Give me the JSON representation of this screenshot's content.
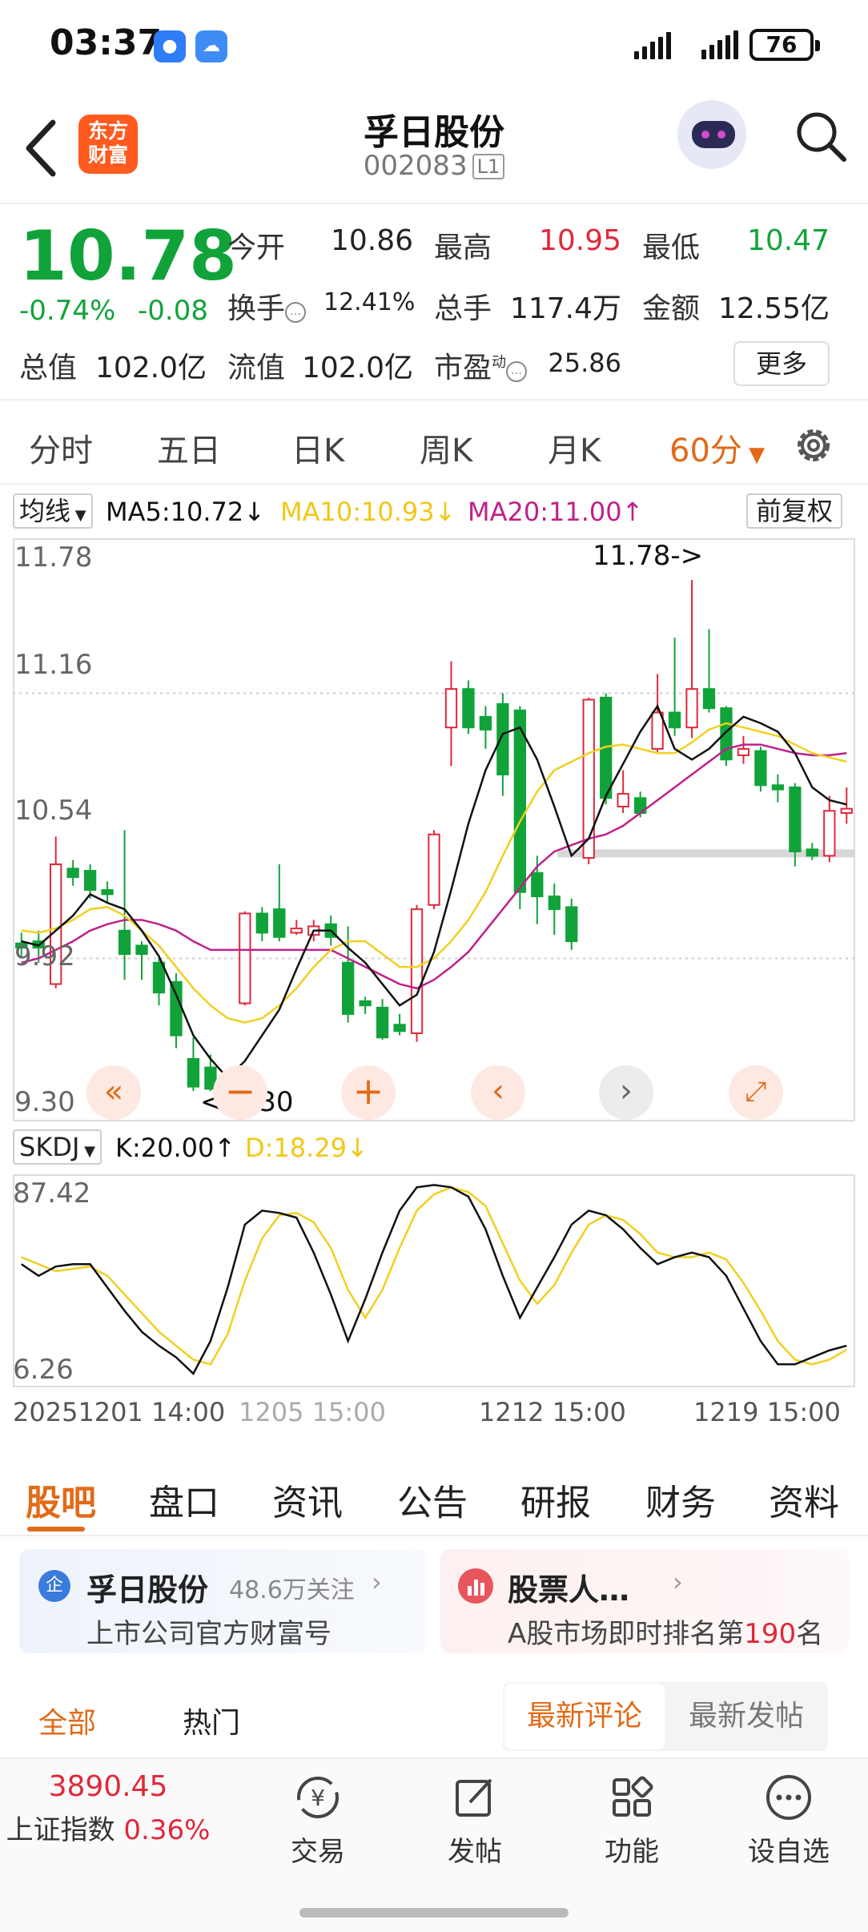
{
  "status_bar": {
    "time": "03:37",
    "battery": "76"
  },
  "header": {
    "logo_line1": "东方",
    "logo_line2": "财富",
    "stock_name": "孚日股份",
    "stock_code": "002083",
    "level_badge": "L1"
  },
  "quote": {
    "price": "10.78",
    "change_pct": "-0.74%",
    "change_amt": "-0.08",
    "open_label": "今开",
    "open": "10.86",
    "high_label": "最高",
    "high": "10.95",
    "low_label": "最低",
    "low": "10.47",
    "turnover_label": "换手",
    "turnover": "12.41%",
    "volume_label": "总手",
    "volume": "117.4万",
    "amount_label": "金额",
    "amount": "12.55亿",
    "mktcap_label": "总值",
    "mktcap": "102.0亿",
    "float_label": "流值",
    "float_cap": "102.0亿",
    "pe_label": "市盈",
    "pe_sup": "动",
    "pe": "25.86",
    "more": "更多"
  },
  "period_tabs": [
    "分时",
    "五日",
    "日K",
    "周K",
    "月K",
    "60分"
  ],
  "ma_legend": {
    "selector": "均线",
    "ma5": "MA5:10.72↓",
    "ma10": "MA10:10.93↓",
    "ma20": "MA20:11.00↑",
    "adjust": "前复权"
  },
  "price_axis": [
    "11.78",
    "11.16",
    "10.54",
    "9.92",
    "9.30"
  ],
  "annotations": {
    "high_marker": "11.78->",
    "low_marker": "<-9.30"
  },
  "indicator": {
    "selector": "SKDJ",
    "k": "K:20.00↑",
    "d": "D:18.29↓",
    "axis_top": "87.42",
    "axis_bottom": "6.26"
  },
  "time_axis": [
    "20251201 14:00",
    "1205 15:00",
    "1212 15:00",
    "1219 15:00"
  ],
  "main_tabs": [
    "股吧",
    "盘口",
    "资讯",
    "公告",
    "研报",
    "财务",
    "资料"
  ],
  "card_left": {
    "badge": "企",
    "title": "孚日股份",
    "followers": "48.6万关注",
    "subtitle": "上市公司官方财富号"
  },
  "card_right": {
    "title": "股票人…",
    "subtitle_prefix": "A股市场即时排名第",
    "rank": "190",
    "subtitle_suffix": "名"
  },
  "filter": {
    "all": "全部",
    "hot": "热门",
    "latest_comment": "最新评论",
    "latest_post": "最新发帖"
  },
  "bottom_bar": {
    "index_value": "3890.45",
    "index_name": "上证指数",
    "index_change": "0.36%",
    "trade": "交易",
    "post": "发帖",
    "functions": "功能",
    "watchlist": "设自选"
  },
  "colors": {
    "up": "#e0283a",
    "down": "#11a33a",
    "accent": "#e26a18",
    "ma5": "#111111",
    "ma10": "#f0d020",
    "ma20": "#c0208a"
  },
  "chart_data": {
    "type": "candlestick",
    "period": "60分",
    "ylim": [
      9.3,
      11.78
    ],
    "candles": [
      {
        "o": 9.99,
        "c": 9.97,
        "h": 10.04,
        "l": 9.93
      },
      {
        "o": 10.0,
        "c": 9.97,
        "h": 10.05,
        "l": 9.9
      },
      {
        "o": 9.8,
        "c": 10.36,
        "h": 10.49,
        "l": 9.78
      },
      {
        "o": 10.34,
        "c": 10.3,
        "h": 10.38,
        "l": 10.26
      },
      {
        "o": 10.33,
        "c": 10.24,
        "h": 10.36,
        "l": 10.2
      },
      {
        "o": 10.24,
        "c": 10.22,
        "h": 10.28,
        "l": 10.18
      },
      {
        "o": 10.05,
        "c": 9.94,
        "h": 10.52,
        "l": 9.82
      },
      {
        "o": 9.98,
        "c": 9.94,
        "h": 10.0,
        "l": 9.82
      },
      {
        "o": 9.9,
        "c": 9.76,
        "h": 9.93,
        "l": 9.7
      },
      {
        "o": 9.81,
        "c": 9.56,
        "h": 9.85,
        "l": 9.5
      },
      {
        "o": 9.45,
        "c": 9.32,
        "h": 9.55,
        "l": 9.3
      },
      {
        "o": 9.41,
        "c": 9.31,
        "h": 9.47,
        "l": 9.3
      },
      {
        "o": 9.31,
        "c": 9.27,
        "h": 9.35,
        "l": 9.27
      },
      {
        "o": 9.71,
        "c": 10.13,
        "h": 10.14,
        "l": 9.7
      },
      {
        "o": 10.13,
        "c": 10.04,
        "h": 10.16,
        "l": 10.0
      },
      {
        "o": 10.15,
        "c": 10.02,
        "h": 10.36,
        "l": 10.0
      },
      {
        "o": 10.04,
        "c": 10.06,
        "h": 10.1,
        "l": 10.03
      },
      {
        "o": 10.03,
        "c": 10.07,
        "h": 10.1,
        "l": 10.0
      },
      {
        "o": 10.08,
        "c": 10.02,
        "h": 10.12,
        "l": 9.98
      },
      {
        "o": 9.9,
        "c": 9.66,
        "h": 10.07,
        "l": 9.62
      },
      {
        "o": 9.72,
        "c": 9.7,
        "h": 9.74,
        "l": 9.66
      },
      {
        "o": 9.69,
        "c": 9.55,
        "h": 9.73,
        "l": 9.54
      },
      {
        "o": 9.61,
        "c": 9.58,
        "h": 9.66,
        "l": 9.56
      },
      {
        "o": 9.57,
        "c": 10.15,
        "h": 10.17,
        "l": 9.53
      },
      {
        "o": 10.17,
        "c": 10.5,
        "h": 10.52,
        "l": 10.15
      },
      {
        "o": 11.0,
        "c": 11.18,
        "h": 11.31,
        "l": 10.82
      },
      {
        "o": 11.18,
        "c": 11.0,
        "h": 11.22,
        "l": 10.97
      },
      {
        "o": 11.05,
        "c": 10.99,
        "h": 11.1,
        "l": 10.9
      },
      {
        "o": 11.11,
        "c": 10.78,
        "h": 11.16,
        "l": 10.68
      },
      {
        "o": 11.08,
        "c": 10.23,
        "h": 11.1,
        "l": 10.15
      },
      {
        "o": 10.32,
        "c": 10.21,
        "h": 10.4,
        "l": 10.08
      },
      {
        "o": 10.21,
        "c": 10.15,
        "h": 10.27,
        "l": 10.03
      },
      {
        "o": 10.16,
        "c": 10.0,
        "h": 10.2,
        "l": 9.96
      },
      {
        "o": 10.39,
        "c": 11.13,
        "h": 11.14,
        "l": 10.36
      },
      {
        "o": 11.14,
        "c": 10.67,
        "h": 11.16,
        "l": 10.64
      },
      {
        "o": 10.63,
        "c": 10.69,
        "h": 10.8,
        "l": 10.6
      },
      {
        "o": 10.67,
        "c": 10.6,
        "h": 10.7,
        "l": 10.58
      },
      {
        "o": 10.9,
        "c": 11.07,
        "h": 11.25,
        "l": 10.88
      },
      {
        "o": 11.07,
        "c": 11.0,
        "h": 11.42,
        "l": 10.96
      },
      {
        "o": 11.0,
        "c": 11.18,
        "h": 11.69,
        "l": 10.95
      },
      {
        "o": 11.18,
        "c": 11.09,
        "h": 11.46,
        "l": 11.07
      },
      {
        "o": 11.09,
        "c": 10.85,
        "h": 11.1,
        "l": 10.82
      },
      {
        "o": 10.87,
        "c": 10.9,
        "h": 10.96,
        "l": 10.83
      },
      {
        "o": 10.89,
        "c": 10.73,
        "h": 10.91,
        "l": 10.7
      },
      {
        "o": 10.73,
        "c": 10.71,
        "h": 10.78,
        "l": 10.65
      },
      {
        "o": 10.72,
        "c": 10.42,
        "h": 10.74,
        "l": 10.35
      },
      {
        "o": 10.43,
        "c": 10.4,
        "h": 10.46,
        "l": 10.38
      },
      {
        "o": 10.4,
        "c": 10.61,
        "h": 10.68,
        "l": 10.37
      },
      {
        "o": 10.6,
        "c": 10.62,
        "h": 10.72,
        "l": 10.55
      }
    ],
    "ma5": [
      10.0,
      9.98,
      10.05,
      10.12,
      10.22,
      10.18,
      10.15,
      10.05,
      9.93,
      9.75,
      9.56,
      9.45,
      9.36,
      9.44,
      9.56,
      9.68,
      9.87,
      10.05,
      10.05,
      9.97,
      9.9,
      9.8,
      9.7,
      9.75,
      9.95,
      10.24,
      10.55,
      10.8,
      10.97,
      11.0,
      10.85,
      10.63,
      10.4,
      10.48,
      10.68,
      10.83,
      10.98,
      11.1,
      10.9,
      10.85,
      10.9,
      10.98,
      11.05,
      11.02,
      10.98,
      10.88,
      10.72,
      10.66,
      10.64
    ],
    "ma10": [
      10.05,
      10.04,
      10.06,
      10.1,
      10.15,
      10.16,
      10.12,
      10.05,
      9.98,
      9.88,
      9.78,
      9.7,
      9.64,
      9.62,
      9.64,
      9.7,
      9.78,
      9.88,
      9.96,
      10.0,
      10.0,
      9.94,
      9.88,
      9.88,
      9.92,
      10.0,
      10.1,
      10.23,
      10.4,
      10.56,
      10.7,
      10.8,
      10.84,
      10.88,
      10.91,
      10.92,
      10.9,
      10.88,
      10.88,
      10.93,
      10.99,
      11.02,
      11.0,
      10.98,
      10.96,
      10.92,
      10.88,
      10.86,
      10.84
    ],
    "ma20": [
      9.9,
      9.92,
      9.96,
      10.0,
      10.05,
      10.08,
      10.1,
      10.1,
      10.08,
      10.05,
      10.0,
      9.96,
      9.96,
      9.96,
      9.96,
      9.96,
      9.96,
      9.96,
      9.96,
      9.92,
      9.88,
      9.84,
      9.8,
      9.78,
      9.82,
      9.88,
      9.95,
      10.05,
      10.15,
      10.25,
      10.35,
      10.42,
      10.45,
      10.48,
      10.5,
      10.54,
      10.6,
      10.66,
      10.72,
      10.78,
      10.84,
      10.9,
      10.92,
      10.92,
      10.9,
      10.88,
      10.87,
      10.87,
      10.88
    ],
    "skdj": {
      "ylim": [
        6.26,
        87.42
      ],
      "k": [
        55,
        50,
        54,
        55,
        55,
        45,
        35,
        26,
        20,
        15,
        8,
        22,
        45,
        72,
        78,
        77,
        75,
        60,
        42,
        22,
        40,
        60,
        78,
        88,
        89,
        88,
        84,
        70,
        50,
        32,
        45,
        58,
        72,
        78,
        76,
        70,
        62,
        55,
        58,
        60,
        58,
        50,
        36,
        22,
        12,
        12,
        15,
        18,
        20
      ],
      "d": [
        58,
        55,
        52,
        53,
        54,
        50,
        42,
        34,
        26,
        20,
        14,
        12,
        25,
        48,
        66,
        76,
        77,
        73,
        62,
        44,
        32,
        44,
        62,
        78,
        85,
        88,
        86,
        80,
        64,
        48,
        38,
        46,
        60,
        72,
        76,
        74,
        68,
        60,
        58,
        58,
        60,
        57,
        47,
        35,
        22,
        14,
        12,
        14,
        18.29
      ]
    }
  }
}
